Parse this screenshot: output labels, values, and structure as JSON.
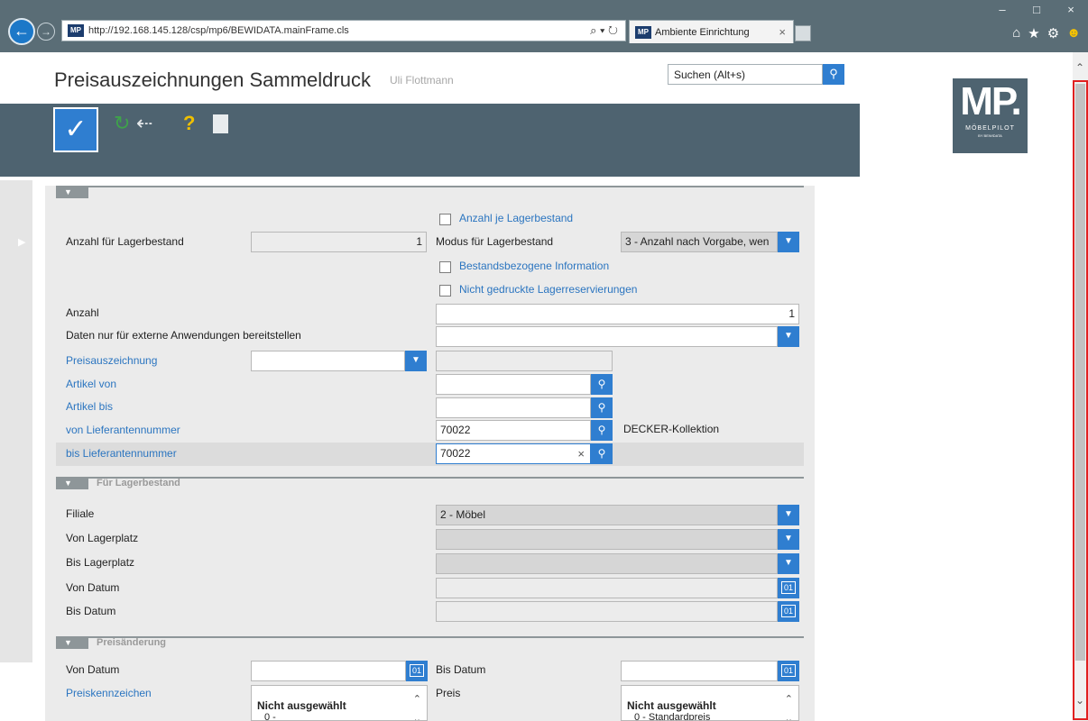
{
  "browser": {
    "url": "http://192.168.145.128/csp/mp6/BEWIDATA.mainFrame.cls",
    "favicon_text": "MP",
    "tab_title": "Ambiente Einrichtung",
    "tab_close": "×",
    "address_tools": "⌕ ▾ ↻",
    "window_controls": [
      "–",
      "□",
      "×"
    ],
    "icons": [
      "home-icon",
      "star-icon",
      "gear-icon",
      "smiley-icon"
    ]
  },
  "header": {
    "title": "Preisauszeichnungen Sammeldruck",
    "user": "Uli Flottmann",
    "search_value": "Suchen (Alt+s)",
    "logo_text": "MP.",
    "logo_sub1": "MÖBELPILOT",
    "logo_sub2": "BY BEWIDATA"
  },
  "section1": {
    "checkbox_anzahl_je_lager": "Anzahl je Lagerbestand",
    "label_anzahl_lager": "Anzahl für Lagerbestand",
    "value_anzahl_lager": "1",
    "label_modus": "Modus für Lagerbestand",
    "value_modus": "3 - Anzahl nach Vorgabe, wen",
    "checkbox_bestand": "Bestandsbezogene Information",
    "checkbox_nicht_gedruckt": "Nicht gedruckte Lagerreservierungen",
    "label_anzahl": "Anzahl",
    "value_anzahl": "1",
    "label_daten_extern": "Daten nur für externe Anwendungen bereitstellen",
    "label_preisauszeichnung": "Preisauszeichnung",
    "label_artikel_von": "Artikel von",
    "label_artikel_bis": "Artikel bis",
    "label_von_lief": "von Lieferantennummer",
    "value_von_lief": "70022",
    "lieferant_name": "DECKER-Kollektion",
    "label_bis_lief": "bis Lieferantennummer",
    "value_bis_lief": "70022",
    "clear_glyph": "×"
  },
  "section2": {
    "title": "Für Lagerbestand",
    "label_filiale": "Filiale",
    "value_filiale": "2 - Möbel",
    "label_von_lagerplatz": "Von Lagerplatz",
    "label_bis_lagerplatz": "Bis Lagerplatz",
    "label_von_datum": "Von Datum",
    "label_bis_datum": "Bis Datum"
  },
  "section3": {
    "title": "Preisänderung",
    "label_von_datum": "Von Datum",
    "label_bis_datum": "Bis Datum",
    "label_preiskennzeichen": "Preiskennzeichen",
    "label_preis": "Preis",
    "list1_header": "Nicht ausgewählt",
    "list1_option": "0 -",
    "list2_header": "Nicht ausgewählt",
    "list2_option": "0 - Standardpreis"
  },
  "colors": {
    "accent": "#2f7ed0",
    "toolbar": "#4e6370",
    "link_label": "#2b75c0",
    "scrollbar_highlight": "#e02020"
  }
}
